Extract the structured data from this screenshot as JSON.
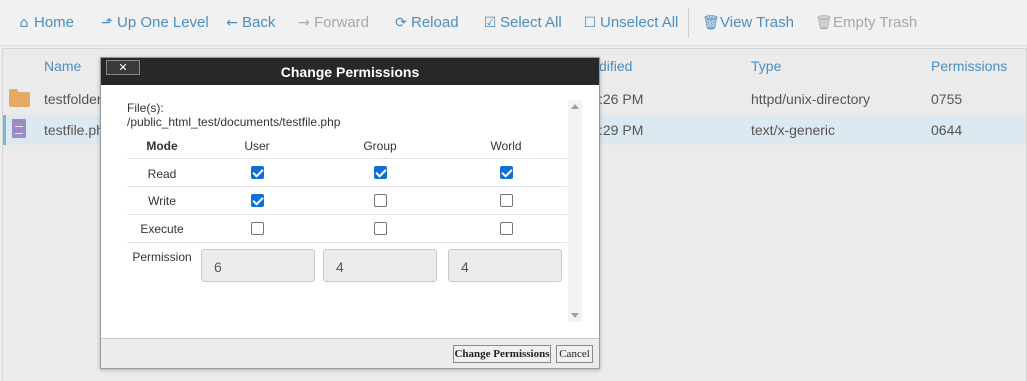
{
  "toolbar": {
    "home": "Home",
    "up": "Up One Level",
    "back": "Back",
    "forward": "Forward",
    "reload": "Reload",
    "select_all": "Select All",
    "unselect_all": "Unselect All",
    "view_trash": "View Trash",
    "empty_trash": "Empty Trash"
  },
  "files": {
    "columns": {
      "name": "Name",
      "modified": "dified",
      "type": "Type",
      "permissions": "Permissions"
    },
    "rows": [
      {
        "name": "testfolder",
        "modified": ":26 PM",
        "type": "httpd/unix-directory",
        "permissions": "0755",
        "icon": "folder-icon"
      },
      {
        "name": "testfile.php",
        "modified": ":29 PM",
        "type": "text/x-generic",
        "permissions": "0644",
        "icon": "file-icon"
      }
    ]
  },
  "dialog": {
    "title": "Change Permissions",
    "close_label": "✕",
    "files_label": "File(s):",
    "file_path": "/public_html_test/documents/testfile.php",
    "headers": {
      "mode": "Mode",
      "user": "User",
      "group": "Group",
      "world": "World"
    },
    "modes": [
      {
        "label": "Read",
        "user": true,
        "group": true,
        "world": true
      },
      {
        "label": "Write",
        "user": true,
        "group": false,
        "world": false
      },
      {
        "label": "Execute",
        "user": false,
        "group": false,
        "world": false
      }
    ],
    "permission_label": "Permission",
    "permission_values": {
      "user": "6",
      "group": "4",
      "world": "4"
    },
    "buttons": {
      "confirm": "Change Permissions",
      "cancel": "Cancel"
    }
  },
  "colors": {
    "link": "#4a8fc1",
    "disabled": "#a8a8a8",
    "selected_row": "#dce9f1",
    "checkbox_on": "#0f6fd8",
    "dialog_title_bg": "#282828"
  }
}
